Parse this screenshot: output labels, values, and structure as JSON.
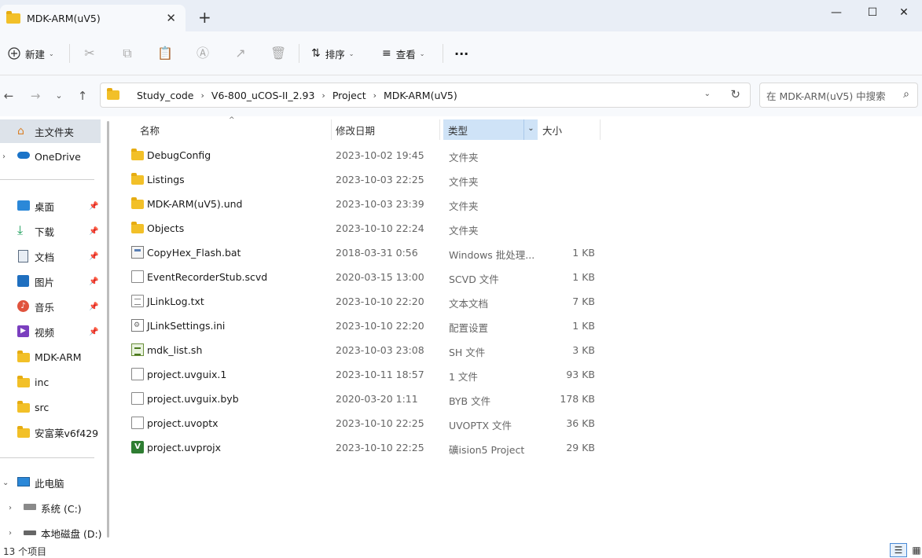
{
  "tab": {
    "title": "MDK-ARM(uV5)",
    "close": "✕",
    "new": "+"
  },
  "window": {
    "minimize": "—",
    "maximize": "☐",
    "close": "✕"
  },
  "toolbar": {
    "new_label": "新建",
    "sort_label": "排序",
    "view_label": "查看",
    "more": "···",
    "dropdown": "⌄"
  },
  "nav": {
    "back": "←",
    "forward": "→",
    "recent": "⌄",
    "up": "↑"
  },
  "address": {
    "crumbs": [
      "Study_code",
      "V6-800_uCOS-II_2.93",
      "Project",
      "MDK-ARM(uV5)"
    ],
    "separator": "›",
    "dropdown": "⌄",
    "refresh": "↻"
  },
  "search": {
    "placeholder": "在 MDK-ARM(uV5) 中搜索",
    "icon": "⌕"
  },
  "sidebar": {
    "home": "主文件夹",
    "onedrive": "OneDrive",
    "quick": [
      {
        "label": "桌面",
        "pin": "📌"
      },
      {
        "label": "下载",
        "pin": "📌"
      },
      {
        "label": "文档",
        "pin": "📌"
      },
      {
        "label": "图片",
        "pin": "📌"
      },
      {
        "label": "音乐",
        "pin": "📌"
      },
      {
        "label": "视频",
        "pin": "📌"
      }
    ],
    "folders": [
      "MDK-ARM",
      "inc",
      "src",
      "安富莱v6f429"
    ],
    "pc": "此电脑",
    "drives": [
      "系统 (C:)",
      "本地磁盘 (D:)"
    ],
    "chev_right": "›",
    "chev_down": "⌄"
  },
  "columns": {
    "name": "名称",
    "date": "修改日期",
    "type": "类型",
    "size": "大小",
    "sort_arrow": "^",
    "type_dd": "⌄"
  },
  "files": [
    {
      "name": "DebugConfig",
      "date": "2023-10-02 19:45",
      "type": "文件夹",
      "size": "",
      "icon": "folder"
    },
    {
      "name": "Listings",
      "date": "2023-10-03 22:25",
      "type": "文件夹",
      "size": "",
      "icon": "folder"
    },
    {
      "name": "MDK-ARM(uV5).und",
      "date": "2023-10-03 23:39",
      "type": "文件夹",
      "size": "",
      "icon": "folder"
    },
    {
      "name": "Objects",
      "date": "2023-10-10 22:24",
      "type": "文件夹",
      "size": "",
      "icon": "folder"
    },
    {
      "name": "CopyHex_Flash.bat",
      "date": "2018-03-31 0:56",
      "type": "Windows 批处理...",
      "size": "1 KB",
      "icon": "bat"
    },
    {
      "name": "EventRecorderStub.scvd",
      "date": "2020-03-15 13:00",
      "type": "SCVD 文件",
      "size": "1 KB",
      "icon": "doc"
    },
    {
      "name": "JLinkLog.txt",
      "date": "2023-10-10 22:20",
      "type": "文本文档",
      "size": "7 KB",
      "icon": "txt"
    },
    {
      "name": "JLinkSettings.ini",
      "date": "2023-10-10 22:20",
      "type": "配置设置",
      "size": "1 KB",
      "icon": "ini"
    },
    {
      "name": "mdk_list.sh",
      "date": "2023-10-03 23:08",
      "type": "SH 文件",
      "size": "3 KB",
      "icon": "sh"
    },
    {
      "name": "project.uvguix.1",
      "date": "2023-10-11 18:57",
      "type": "1 文件",
      "size": "93 KB",
      "icon": "doc"
    },
    {
      "name": "project.uvguix.byb",
      "date": "2020-03-20 1:11",
      "type": "BYB 文件",
      "size": "178 KB",
      "icon": "doc"
    },
    {
      "name": "project.uvoptx",
      "date": "2023-10-10 22:25",
      "type": "UVOPTX 文件",
      "size": "36 KB",
      "icon": "doc"
    },
    {
      "name": "project.uvprojx",
      "date": "2023-10-10 22:25",
      "type": "礦ision5 Project",
      "size": "29 KB",
      "icon": "uv"
    }
  ],
  "status": {
    "count": "13 个项目",
    "details_view": "☰",
    "tiles_view": "▦"
  }
}
